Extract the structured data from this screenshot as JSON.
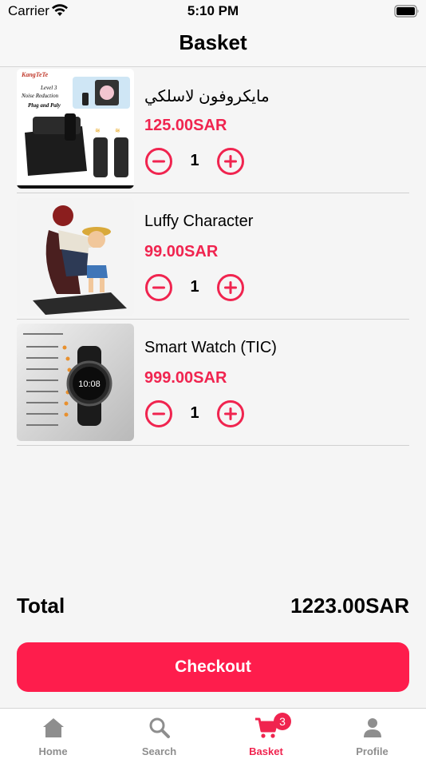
{
  "status_bar": {
    "carrier": "Carrier",
    "time": "5:10 PM"
  },
  "header": {
    "title": "Basket"
  },
  "items": [
    {
      "name": "مايكروفون لاسلكي",
      "price": "125.00SAR",
      "quantity": "1"
    },
    {
      "name": "Luffy Character",
      "price": "99.00SAR",
      "quantity": "1"
    },
    {
      "name": "Smart Watch (TIC)",
      "price": "999.00SAR",
      "quantity": "1"
    }
  ],
  "product_image_text": {
    "mic_brand": "KangTeTe",
    "mic_line1": "Level 3",
    "mic_line2": "Noise Reduction",
    "mic_line3": "Plug and Paly",
    "watch_time": "10:08"
  },
  "summary": {
    "total_label": "Total",
    "total_value": "1223.00SAR"
  },
  "checkout": {
    "label": "Checkout"
  },
  "tabs": [
    {
      "label": "Home",
      "icon": "home-icon"
    },
    {
      "label": "Search",
      "icon": "search-icon"
    },
    {
      "label": "Basket",
      "icon": "cart-icon",
      "badge": "3"
    },
    {
      "label": "Profile",
      "icon": "person-icon"
    }
  ],
  "colors": {
    "accent": "#fe1d4c",
    "price": "#f0244f",
    "inactive_tab": "#8e8e8e"
  }
}
